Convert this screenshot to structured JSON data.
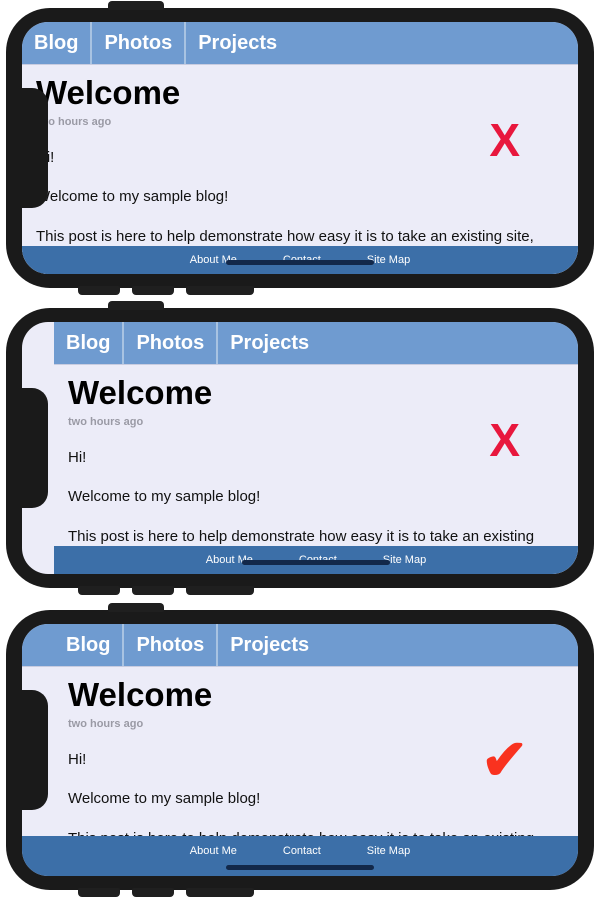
{
  "page": {
    "background_color": "#ffffff",
    "frame_color": "#1a1a1a",
    "screen_background": "#ececf8",
    "navbar_color": "#6f9bd0",
    "footer_color": "#3c6fa8",
    "x_mark_color": "#e8173d",
    "check_mark_color": "#f9321f"
  },
  "nav": {
    "items": [
      {
        "label": "Blog"
      },
      {
        "label": "Photos"
      },
      {
        "label": "Projects"
      }
    ]
  },
  "post": {
    "title": "Welcome",
    "meta": "two hours ago",
    "paragraphs": [
      "Hi!",
      "Welcome to my sample blog!",
      "This post is here to help demonstrate how easy it is to take an existing site, along with full-width bars and fixed-position elements, and make it take full advantage of iPhone X's edge-to-edge display."
    ]
  },
  "footer": {
    "links": [
      {
        "label": "About Me"
      },
      {
        "label": "Contact"
      },
      {
        "label": "Site Map"
      }
    ]
  },
  "panels": [
    {
      "id": "panel-1",
      "status": "bad",
      "mark": "✘",
      "mark_glyph": "X"
    },
    {
      "id": "panel-2",
      "status": "bad",
      "mark": "✘",
      "mark_glyph": "X"
    },
    {
      "id": "panel-3",
      "status": "good",
      "mark": "✔",
      "mark_glyph": "✔"
    }
  ]
}
